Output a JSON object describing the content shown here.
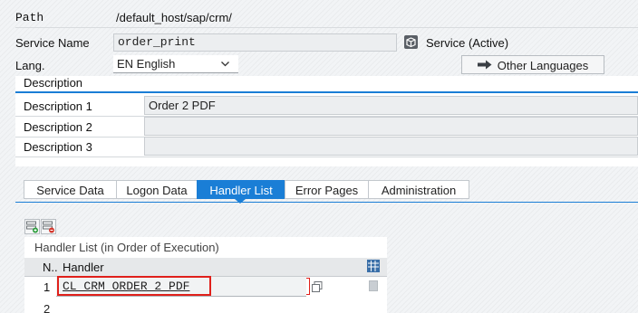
{
  "header": {
    "path_label": "Path",
    "path_value": "/default_host/sap/crm/",
    "service_name_label": "Service Name",
    "service_name_value": "order_print",
    "service_status": "Service (Active)",
    "lang_label": "Lang.",
    "lang_value": "EN English",
    "other_languages_label": "Other Languages"
  },
  "description": {
    "title": "Description",
    "rows": [
      {
        "label": "Description 1",
        "value": "Order 2 PDF"
      },
      {
        "label": "Description 2",
        "value": ""
      },
      {
        "label": "Description 3",
        "value": ""
      }
    ]
  },
  "tabs": [
    {
      "label": "Service Data"
    },
    {
      "label": "Logon Data"
    },
    {
      "label": "Handler List"
    },
    {
      "label": "Error Pages"
    },
    {
      "label": "Administration"
    }
  ],
  "handler_list": {
    "title": "Handler List (in Order of Execution)",
    "col_n": "N..",
    "col_handler": "Handler",
    "rows": [
      {
        "n": "1",
        "handler": "CL_CRM_ORDER_2_PDF"
      },
      {
        "n": "2",
        "handler": ""
      }
    ]
  },
  "colors": {
    "accent": "#1a7ed6",
    "highlight": "#e0201b"
  }
}
